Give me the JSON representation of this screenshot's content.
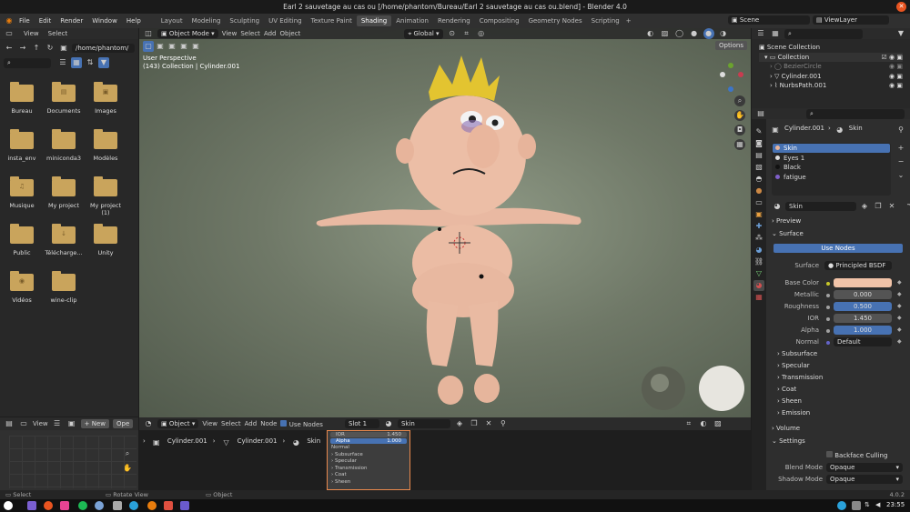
{
  "window": {
    "title": "Earl 2 sauvetage au cas ou [/home/phantom/Bureau/Earl 2 sauvetage au cas ou.blend] - Blender 4.0"
  },
  "topbar": {
    "menus": [
      "File",
      "Edit",
      "Render",
      "Window",
      "Help"
    ],
    "workspaces": [
      "Layout",
      "Modeling",
      "Sculpting",
      "UV Editing",
      "Texture Paint",
      "Shading",
      "Animation",
      "Rendering",
      "Compositing",
      "Geometry Nodes",
      "Scripting"
    ],
    "active_workspace": "Shading",
    "scene": "Scene",
    "view_layer": "ViewLayer"
  },
  "filebrowser": {
    "menus": [
      "View",
      "Select"
    ],
    "path": "/home/phantom/",
    "folders": [
      {
        "label": "Bureau",
        "glyph": ""
      },
      {
        "label": "Documents",
        "glyph": "▤"
      },
      {
        "label": "Images",
        "glyph": "▣"
      },
      {
        "label": "insta_env",
        "glyph": ""
      },
      {
        "label": "miniconda3",
        "glyph": ""
      },
      {
        "label": "Modèles",
        "glyph": ""
      },
      {
        "label": "Musique",
        "glyph": "♫"
      },
      {
        "label": "My project",
        "glyph": ""
      },
      {
        "label": "My project (1)",
        "glyph": ""
      },
      {
        "label": "Public",
        "glyph": ""
      },
      {
        "label": "Télécharge...",
        "glyph": "↓"
      },
      {
        "label": "Unity",
        "glyph": ""
      },
      {
        "label": "Vidéos",
        "glyph": "◉"
      },
      {
        "label": "wine-clip",
        "glyph": ""
      }
    ]
  },
  "viewport": {
    "mode": "Object Mode",
    "menus": [
      "View",
      "Select",
      "Add",
      "Object"
    ],
    "orientation": "Global",
    "options": "Options",
    "info_line1": "User Perspective",
    "info_line2": "(143) Collection | Cylinder.001"
  },
  "node_editor": {
    "editor": "Object",
    "menus": [
      "View",
      "Select",
      "Add",
      "Node"
    ],
    "use_nodes": "Use Nodes",
    "slot": "Slot 1",
    "material": "Skin",
    "breadcrumb": [
      "Cylinder.001",
      "Cylinder.001",
      "Skin"
    ],
    "node_rows": [
      {
        "label": "IOR",
        "value": "1.450"
      },
      {
        "label": "Alpha",
        "value": "1.000"
      }
    ],
    "node_items": [
      "Normal",
      "Subsurface",
      "Specular",
      "Transmission",
      "Coat",
      "Sheen"
    ]
  },
  "small_editor": {
    "menus": [
      "View"
    ],
    "new": "New",
    "open": "Ope"
  },
  "outliner": {
    "scene_collection": "Scene Collection",
    "collection": "Collection",
    "items": [
      {
        "label": "BezierCircle",
        "dim": true
      },
      {
        "label": "Cylinder.001",
        "dim": false
      },
      {
        "label": "NurbsPath.001",
        "dim": false
      }
    ]
  },
  "properties": {
    "object": "Cylinder.001",
    "material": "Skin",
    "slots": [
      "Skin",
      "Eyes 1",
      "Black",
      "fatigue"
    ],
    "slot_colors": [
      "#e8b49a",
      "#dddddd",
      "#111111",
      "#7f5fc9"
    ],
    "mat_name": "Skin",
    "preview": "Preview",
    "surface": "Surface",
    "use_nodes": "Use Nodes",
    "surface_label": "Surface",
    "surface_value": "Principled BSDF",
    "fields": [
      {
        "label": "Base Color",
        "value": "",
        "type": "color"
      },
      {
        "label": "Metallic",
        "value": "0.000",
        "type": "num"
      },
      {
        "label": "Roughness",
        "value": "0.500",
        "type": "bar"
      },
      {
        "label": "IOR",
        "value": "1.450",
        "type": "num"
      },
      {
        "label": "Alpha",
        "value": "1.000",
        "type": "bar"
      },
      {
        "label": "Normal",
        "value": "Default",
        "type": "text"
      }
    ],
    "base_color": "#f1c3a8",
    "subsections": [
      "Subsurface",
      "Specular",
      "Transmission",
      "Coat",
      "Sheen",
      "Emission"
    ],
    "volume": "Volume",
    "settings": "Settings",
    "backface": "Backface Culling",
    "blend_mode_label": "Blend Mode",
    "blend_mode": "Opaque",
    "shadow_mode_label": "Shadow Mode",
    "shadow_mode": "Opaque"
  },
  "status": {
    "select": "Select",
    "rotate": "Rotate View",
    "object": "Object",
    "version": "4.0.2"
  },
  "taskbar": {
    "time": "23:55"
  }
}
